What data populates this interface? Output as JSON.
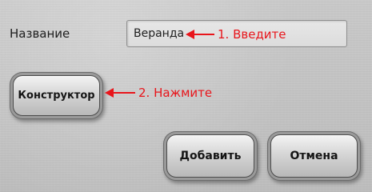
{
  "form": {
    "name_label": "Название",
    "name_value": "Веранда"
  },
  "buttons": {
    "constructor_label": "Конструктор",
    "add_label": "Добавить",
    "cancel_label": "Отмена"
  },
  "annotations": {
    "step1_text": "1. Введите",
    "step2_text": "2. Нажмите",
    "color": "#e8151b",
    "icon": "arrow-left-icon"
  }
}
